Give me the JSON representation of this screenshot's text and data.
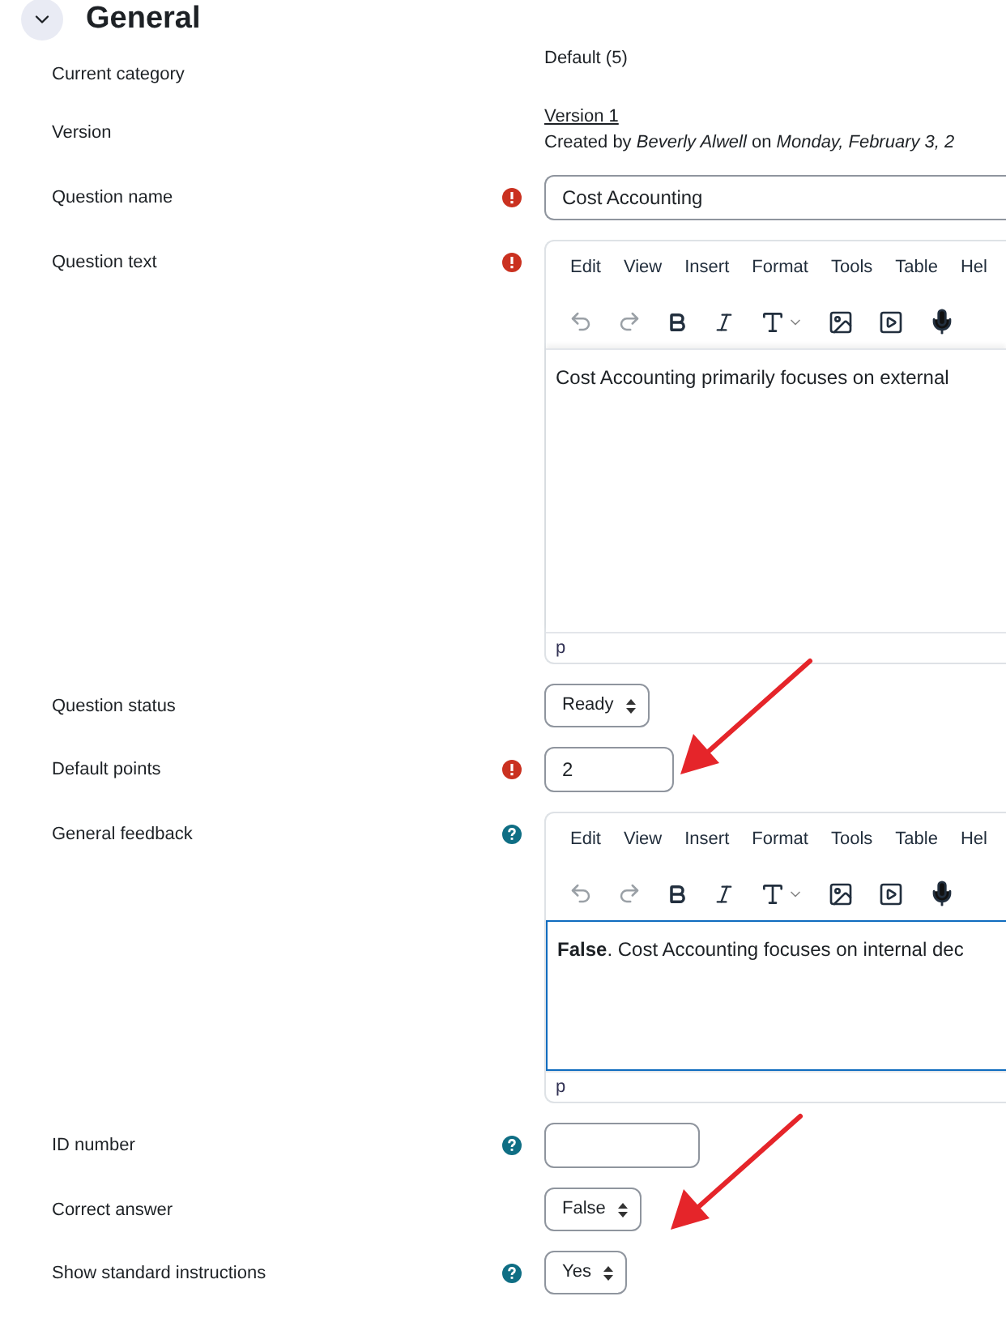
{
  "section": {
    "title": "General",
    "expanded": true
  },
  "fields": [
    {
      "kind": "text",
      "label": "Current category",
      "value": "Default (5)"
    },
    {
      "kind": "version",
      "label": "Version",
      "link": "Version 1",
      "created": "Created by *Beverly Alwell* on *Monday, February 3, 2*"
    },
    {
      "kind": "input",
      "label": "Question name",
      "required": true,
      "value": "Cost Accounting"
    },
    {
      "kind": "editor",
      "label": "Question text",
      "required": true,
      "menu": [
        "Edit",
        "View",
        "Insert",
        "Format",
        "Tools",
        "Table",
        "Hel"
      ],
      "content": "Cost Accounting primarily focuses on external",
      "path": "p",
      "focused": false
    },
    {
      "kind": "select",
      "label": "Question status",
      "value": "Ready"
    },
    {
      "kind": "points",
      "label": "Default points",
      "required": true,
      "value": "2"
    },
    {
      "kind": "feedback",
      "label": "General feedback",
      "help": true,
      "menu": [
        "Edit",
        "View",
        "Insert",
        "Format",
        "Tools",
        "Table",
        "Hel"
      ],
      "content": "**False**. Cost Accounting focuses on internal dec",
      "path": "p",
      "focused": true
    },
    {
      "kind": "identifier",
      "label": "ID number",
      "help": true
    },
    {
      "kind": "select",
      "label": "Correct answer",
      "value": "False"
    },
    {
      "kind": "select",
      "label": "Show standard instructions",
      "help": true,
      "value": "Yes"
    }
  ]
}
